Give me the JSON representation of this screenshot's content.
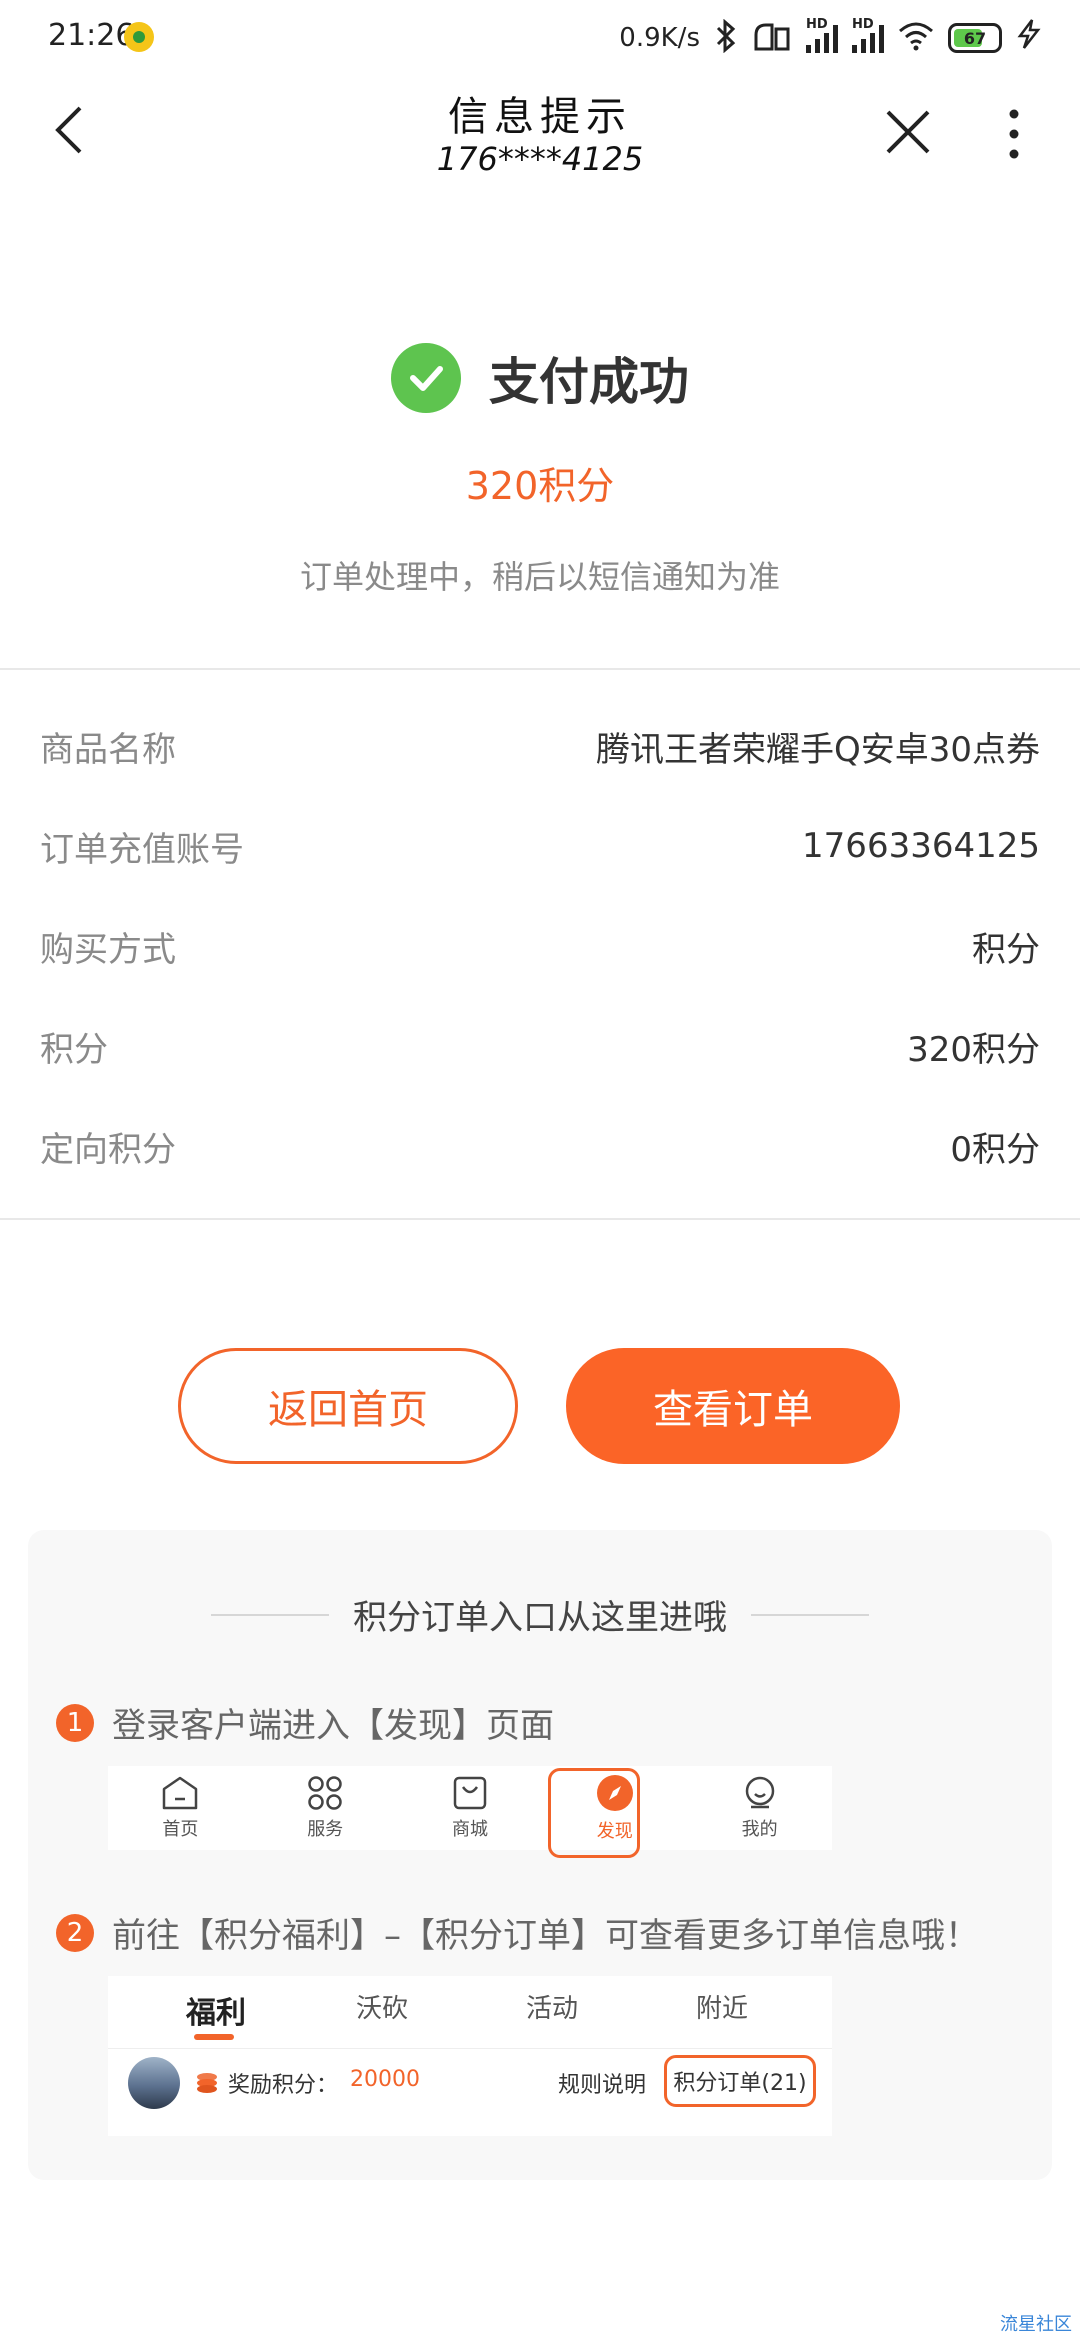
{
  "status_bar": {
    "time": "21:26",
    "net_speed": "0.9K/s",
    "signal1_label": "HD",
    "signal2_label": "HD",
    "battery": "67"
  },
  "nav": {
    "title": "信息提示",
    "subtitle": "176****4125"
  },
  "result": {
    "title": "支付成功",
    "amount": "320积分",
    "message": "订单处理中，稍后以短信通知为准"
  },
  "details": [
    {
      "label": "商品名称",
      "value": "腾讯王者荣耀手Q安卓30点券"
    },
    {
      "label": "订单充值账号",
      "value": "17663364125"
    },
    {
      "label": "购买方式",
      "value": "积分"
    },
    {
      "label": "积分",
      "value": "320积分"
    },
    {
      "label": "定向积分",
      "value": "0积分"
    }
  ],
  "buttons": {
    "home": "返回首页",
    "view_order": "查看订单"
  },
  "guide": {
    "title": "积分订单入口从这里进哦",
    "step1_num": "1",
    "step1": "登录客户端进入【发现】页面",
    "step2_num": "2",
    "step2": "前往【积分福利】–【积分订单】可查看更多订单信息哦！",
    "tabbar": [
      {
        "label": "首页",
        "icon": "home-icon"
      },
      {
        "label": "服务",
        "icon": "grid-icon"
      },
      {
        "label": "商城",
        "icon": "shopping-bag-icon"
      },
      {
        "label": "发现",
        "icon": "compass-icon"
      },
      {
        "label": "我的",
        "icon": "profile-icon"
      }
    ],
    "welfare_tabs": [
      "福利",
      "沃砍",
      "活动",
      "附近"
    ],
    "reward_label": "奖励积分：",
    "reward_value": "20000",
    "rules": "规则说明",
    "points_order": "积分订单(21)"
  },
  "watermark": "流星社区",
  "colors": {
    "accent": "#f2642a",
    "primary_button": "#fb6427",
    "success": "#5ec44f"
  }
}
